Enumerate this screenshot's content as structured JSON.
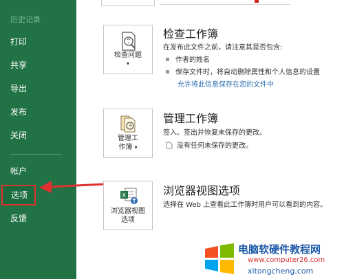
{
  "sidebar": {
    "history_label": "历史记录",
    "items": [
      {
        "label": "打印"
      },
      {
        "label": "共享"
      },
      {
        "label": "导出"
      },
      {
        "label": "发布"
      },
      {
        "label": "关闭"
      },
      {
        "label": "帐户"
      },
      {
        "label": "选项"
      },
      {
        "label": "反馈"
      }
    ]
  },
  "inspect": {
    "tile_label": "检查问题",
    "tile_caret": "▾",
    "title": "检查工作簿",
    "description": "在发布此文件之前，请注意其是否包含:",
    "bullets": [
      "作者的姓名",
      "保存文件时，将自动删除属性和个人信息的设置"
    ],
    "link": "允许将此信息保存在您的文件中"
  },
  "manage": {
    "tile_label_1": "管理工",
    "tile_label_2": "作簿",
    "tile_caret": "▾",
    "title": "管理工作簿",
    "description": "签入、签出并恢复未保存的更改。",
    "note": "没有任何未保存的更改。"
  },
  "browser": {
    "tile_label_1": "浏览器视图",
    "tile_label_2": "选项",
    "title": "浏览器视图选项",
    "description": "选择在 Web 上查看此工作簿时用户可以看到的内容。"
  },
  "watermark": {
    "line1": "电脑软硬件教程网",
    "line2": "www.computer26.com",
    "line3": "xitongcheng.com"
  },
  "colors": {
    "sidebar": "#217346",
    "accent_red": "#e03030",
    "link": "#2b6cb0"
  }
}
